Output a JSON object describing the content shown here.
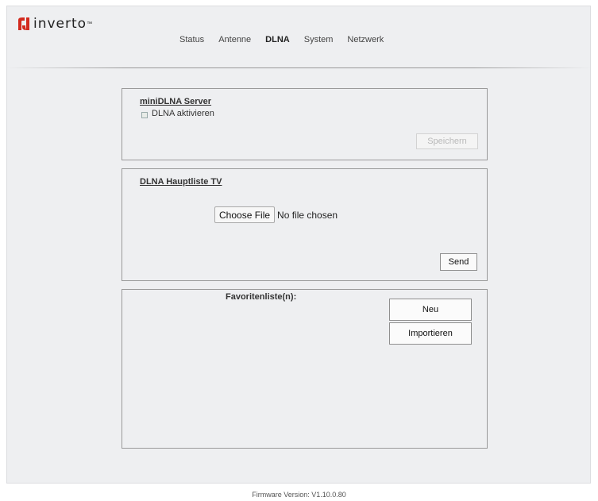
{
  "brand": {
    "name": "inverto",
    "tm": "™",
    "color": "#d22a1e"
  },
  "nav": {
    "items": [
      {
        "label": "Status",
        "active": false
      },
      {
        "label": "Antenne",
        "active": false
      },
      {
        "label": "DLNA",
        "active": true
      },
      {
        "label": "System",
        "active": false
      },
      {
        "label": "Netzwerk",
        "active": false
      }
    ]
  },
  "minidlna": {
    "title": "miniDLNA Server",
    "checkbox_label": "DLNA aktivieren",
    "checkbox_checked": false,
    "save_label": "Speichern"
  },
  "hauptliste": {
    "title": "DLNA Hauptliste TV",
    "choose_file_label": "Choose File",
    "file_status": "No file chosen",
    "send_label": "Send"
  },
  "favoriten": {
    "title": "Favoritenliste(n):",
    "new_label": "Neu",
    "import_label": "Importieren"
  },
  "footer": {
    "firmware": "Firmware Version: V1.10.0.80"
  }
}
